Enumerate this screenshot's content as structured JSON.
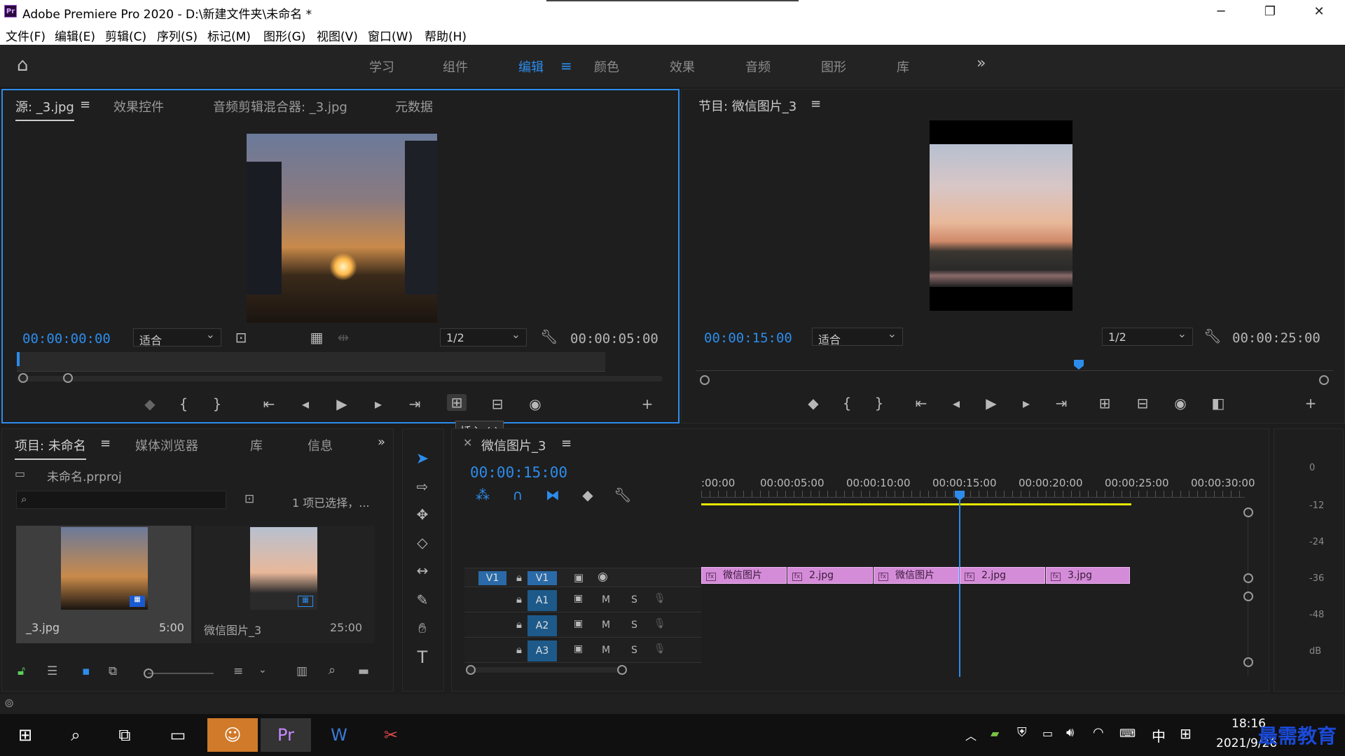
{
  "window": {
    "title": "Adobe Premiere Pro 2020 - D:\\新建文件夹\\未命名 *",
    "logo": "Pr",
    "controls": [
      "─",
      "❐",
      "✕"
    ]
  },
  "menu": [
    "文件(F)",
    "编辑(E)",
    "剪辑(C)",
    "序列(S)",
    "标记(M)",
    "图形(G)",
    "视图(V)",
    "窗口(W)",
    "帮助(H)"
  ],
  "workspaces": {
    "items": [
      "学习",
      "组件",
      "编辑",
      "颜色",
      "效果",
      "音频",
      "图形",
      "库"
    ],
    "active": "编辑",
    "more": "»"
  },
  "source": {
    "tabs": [
      "源: _3.jpg",
      "效果控件",
      "音频剪辑混合器: _3.jpg",
      "元数据"
    ],
    "timecode": "00:00:00:00",
    "fit": "适合",
    "resolution": "1/2",
    "duration": "00:00:05:00",
    "tooltip": "插入 (,)"
  },
  "program": {
    "tab": "节目: 微信图片_3",
    "timecode": "00:00:15:00",
    "fit": "适合",
    "resolution": "1/2",
    "duration": "00:00:25:00",
    "playhead_fraction": 0.6
  },
  "project": {
    "tabs": [
      "项目: 未命名",
      "媒体浏览器",
      "库",
      "信息"
    ],
    "file": "未命名.prproj",
    "selection": "1 项已选择，...",
    "items": [
      {
        "name": "_3.jpg",
        "duration": "5:00"
      },
      {
        "name": "微信图片_3",
        "duration": "25:00"
      }
    ]
  },
  "timeline": {
    "tab": "微信图片_3",
    "timecode": "00:00:15:00",
    "ruler": [
      ":00:00",
      "00:00:05:00",
      "00:00:10:00",
      "00:00:15:00",
      "00:00:20:00",
      "00:00:25:00",
      "00:00:30:00"
    ],
    "tracks": [
      {
        "src": "V1",
        "name": "V1"
      },
      {
        "name": "A1",
        "m": "M",
        "s": "S"
      },
      {
        "name": "A2",
        "m": "M",
        "s": "S"
      },
      {
        "name": "A3",
        "m": "M",
        "s": "S"
      }
    ],
    "clips": [
      "微信图片",
      "2.jpg",
      "微信图片",
      "2.jpg",
      "3.jpg"
    ]
  },
  "meter": [
    "0",
    "-12",
    "-24",
    "-36",
    "-48",
    "dB"
  ],
  "taskbar": {
    "time": "18:16",
    "date": "2021/9/26",
    "ime": "中",
    "watermark": "最需教育"
  },
  "colors": {
    "accent": "#2d8ceb",
    "clip": "#d48cd8",
    "bg": "#1d1d1d"
  }
}
